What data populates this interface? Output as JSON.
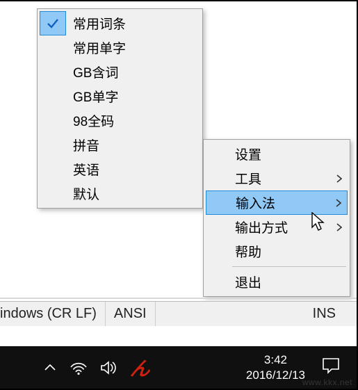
{
  "submenu": {
    "items": [
      {
        "label": "常用词条",
        "checked": true
      },
      {
        "label": "常用单字",
        "checked": false
      },
      {
        "label": "GB含词",
        "checked": false
      },
      {
        "label": "GB单字",
        "checked": false
      },
      {
        "label": "98全码",
        "checked": false
      },
      {
        "label": "拼音",
        "checked": false
      },
      {
        "label": "英语",
        "checked": false
      },
      {
        "label": "默认",
        "checked": false
      }
    ]
  },
  "mainmenu": {
    "items": [
      {
        "label": "设置",
        "has_submenu": false
      },
      {
        "label": "工具",
        "has_submenu": true
      },
      {
        "label": "输入法",
        "has_submenu": true,
        "highlighted": true
      },
      {
        "label": "输出方式",
        "has_submenu": true
      },
      {
        "label": "帮助",
        "has_submenu": false
      },
      {
        "label": "退出",
        "has_submenu": false
      }
    ],
    "separator_after_index": 4
  },
  "statusbar": {
    "encoding_line": "indows (CR LF)",
    "encoding_charset": "ANSI",
    "mode": "INS"
  },
  "taskbar": {
    "time": "3:42",
    "date": "2016/12/13"
  },
  "watermark": "www.kkx.net",
  "colors": {
    "highlight_bg": "#90c8f6",
    "highlight_border": "#2089d8",
    "ime_red": "#d02010"
  }
}
